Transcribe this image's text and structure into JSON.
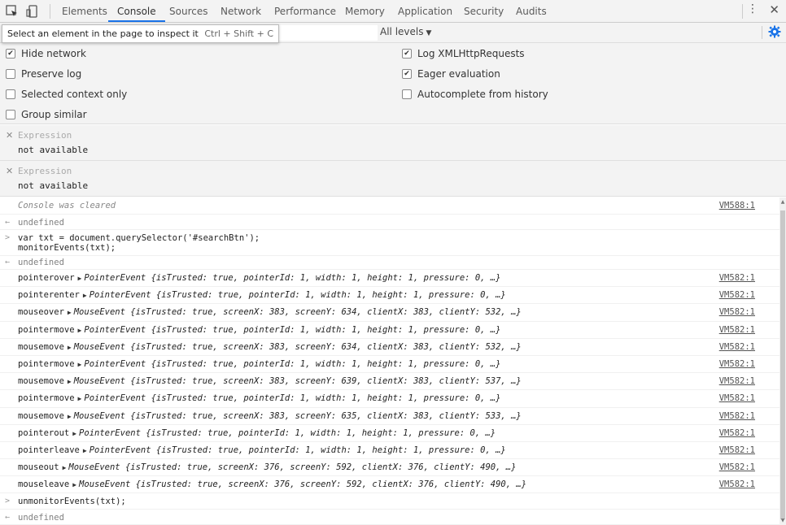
{
  "tabs": [
    "Elements",
    "Console",
    "Sources",
    "Network",
    "Performance",
    "Memory",
    "Application",
    "Security",
    "Audits"
  ],
  "selected_tab": "Console",
  "tooltip": {
    "text": "Select an element in the page to inspect it",
    "shortcut": "Ctrl + Shift + C"
  },
  "filter": {
    "levels_label": "All levels"
  },
  "settings": {
    "hide_network": {
      "label": "Hide network",
      "checked": true
    },
    "preserve_log": {
      "label": "Preserve log",
      "checked": false
    },
    "selected_context": {
      "label": "Selected context only",
      "checked": false
    },
    "group_similar": {
      "label": "Group similar",
      "checked": false
    },
    "log_xhr": {
      "label": "Log XMLHttpRequests",
      "checked": true
    },
    "eager_eval": {
      "label": "Eager evaluation",
      "checked": true
    },
    "autocomplete": {
      "label": "Autocomplete from history",
      "checked": false
    }
  },
  "expressions": [
    {
      "label": "Expression",
      "value": "not available"
    },
    {
      "label": "Expression",
      "value": "not available"
    }
  ],
  "console": {
    "cleared": {
      "text": "Console was cleared",
      "link": "VM588:1"
    },
    "undefined_label": "undefined",
    "input_line1": "var txt = document.querySelector('#searchBtn');",
    "input_line2": "monitorEvents(txt);",
    "events": [
      {
        "name": "pointerover",
        "type": "PointerEvent",
        "args": "{isTrusted: true, pointerId: 1, width: 1, height: 1, pressure: 0, …}",
        "link": "VM582:1"
      },
      {
        "name": "pointerenter",
        "type": "PointerEvent",
        "args": "{isTrusted: true, pointerId: 1, width: 1, height: 1, pressure: 0, …}",
        "link": "VM582:1"
      },
      {
        "name": "mouseover",
        "type": "MouseEvent",
        "args": "{isTrusted: true, screenX: 383, screenY: 634, clientX: 383, clientY: 532, …}",
        "link": "VM582:1"
      },
      {
        "name": "pointermove",
        "type": "PointerEvent",
        "args": "{isTrusted: true, pointerId: 1, width: 1, height: 1, pressure: 0, …}",
        "link": "VM582:1"
      },
      {
        "name": "mousemove",
        "type": "MouseEvent",
        "args": "{isTrusted: true, screenX: 383, screenY: 634, clientX: 383, clientY: 532, …}",
        "link": "VM582:1"
      },
      {
        "name": "pointermove",
        "type": "PointerEvent",
        "args": "{isTrusted: true, pointerId: 1, width: 1, height: 1, pressure: 0, …}",
        "link": "VM582:1"
      },
      {
        "name": "mousemove",
        "type": "MouseEvent",
        "args": "{isTrusted: true, screenX: 383, screenY: 639, clientX: 383, clientY: 537, …}",
        "link": "VM582:1"
      },
      {
        "name": "pointermove",
        "type": "PointerEvent",
        "args": "{isTrusted: true, pointerId: 1, width: 1, height: 1, pressure: 0, …}",
        "link": "VM582:1"
      },
      {
        "name": "mousemove",
        "type": "MouseEvent",
        "args": "{isTrusted: true, screenX: 383, screenY: 635, clientX: 383, clientY: 533, …}",
        "link": "VM582:1"
      },
      {
        "name": "pointerout",
        "type": "PointerEvent",
        "args": "{isTrusted: true, pointerId: 1, width: 1, height: 1, pressure: 0, …}",
        "link": "VM582:1"
      },
      {
        "name": "pointerleave",
        "type": "PointerEvent",
        "args": "{isTrusted: true, pointerId: 1, width: 1, height: 1, pressure: 0, …}",
        "link": "VM582:1"
      },
      {
        "name": "mouseout",
        "type": "MouseEvent",
        "args": "{isTrusted: true, screenX: 376, screenY: 592, clientX: 376, clientY: 490, …}",
        "link": "VM582:1"
      },
      {
        "name": "mouseleave",
        "type": "MouseEvent",
        "args": "{isTrusted: true, screenX: 376, screenY: 592, clientX: 376, clientY: 490, …}",
        "link": "VM582:1"
      }
    ],
    "input_last": "unmonitorEvents(txt);"
  },
  "colors": {
    "accent": "#1a73e8",
    "toolbar_bg": "#f3f3f3"
  }
}
